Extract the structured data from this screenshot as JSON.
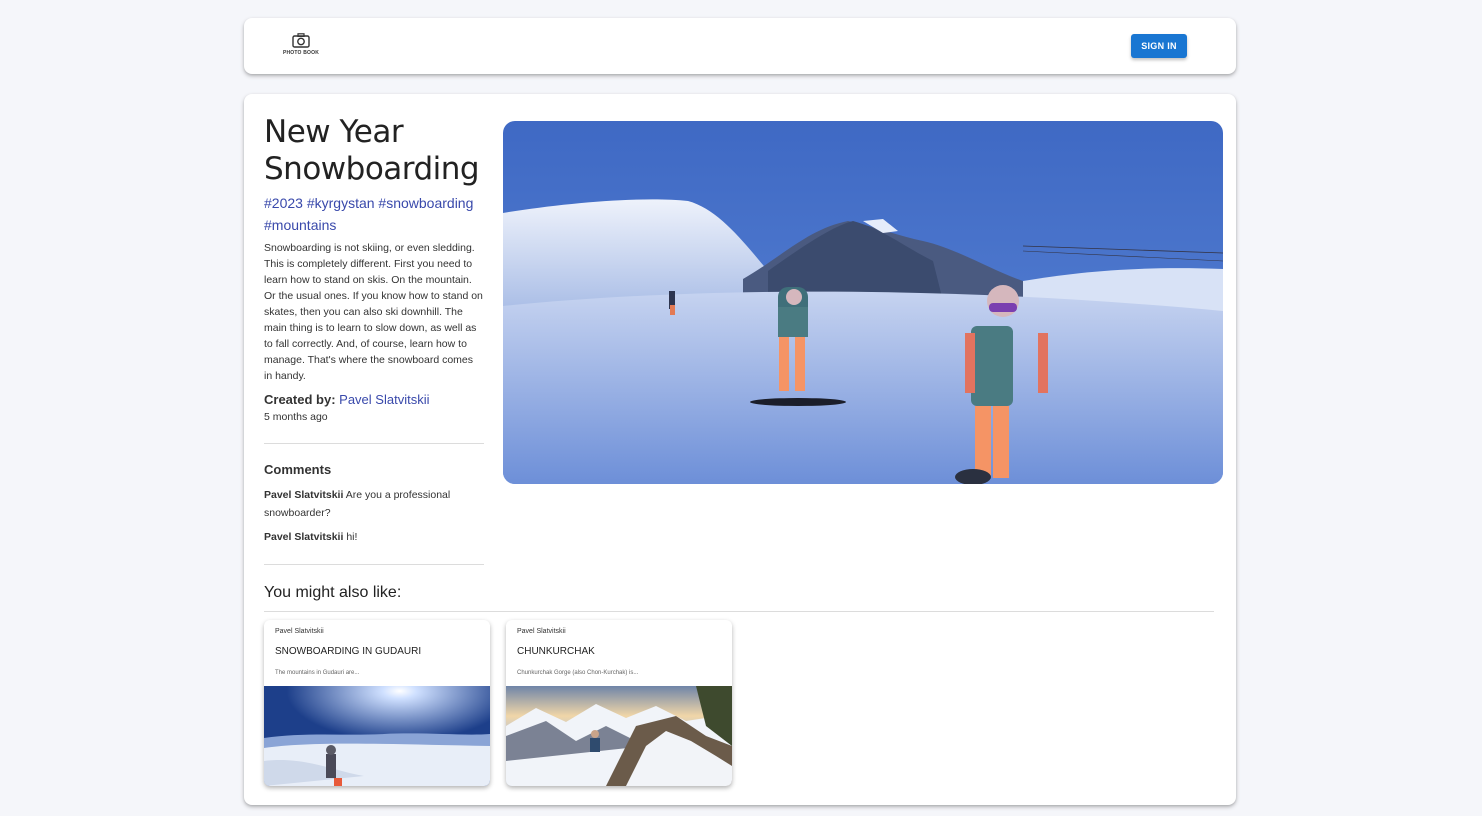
{
  "header": {
    "logo_text": "PHOTO BOOK",
    "sign_in_label": "SIGN IN"
  },
  "post": {
    "title": "New Year Snowboarding",
    "tags": [
      "#2023",
      "#kyrgystan",
      "#snowboarding",
      "#mountains"
    ],
    "description": "Snowboarding is not skiing, or even sledding. This is completely different. First you need to learn how to stand on skis. On the mountain. Or the usual ones. If you know how to stand on skates, then you can also ski downhill. The main thing is to learn to slow down, as well as to fall correctly. And, of course, learn how to manage. That's where the snowboard comes in handy.",
    "created_by_label": "Created by:",
    "creator": "Pavel Slatvitskii",
    "time_ago": "5 months ago"
  },
  "comments": {
    "title": "Comments",
    "items": [
      {
        "author": "Pavel Slatvitskii",
        "text": "Are you a professional snowboarder?"
      },
      {
        "author": "Pavel Slatvitskii",
        "text": "hi!"
      }
    ]
  },
  "suggestions": {
    "title": "You might also like:",
    "items": [
      {
        "author": "Pavel Slatvitskii",
        "title": "SNOWBOARDING IN GUDAURI",
        "description": "The mountains in Gudauri are..."
      },
      {
        "author": "Pavel Slatvitskii",
        "title": "CHUNKURCHAK",
        "description": "Chunkurchak Gorge (also Chon-Kurchak) is..."
      }
    ]
  },
  "colors": {
    "accent": "#1976d2",
    "link": "#3949ab",
    "page_background": "#f5f6fa"
  }
}
